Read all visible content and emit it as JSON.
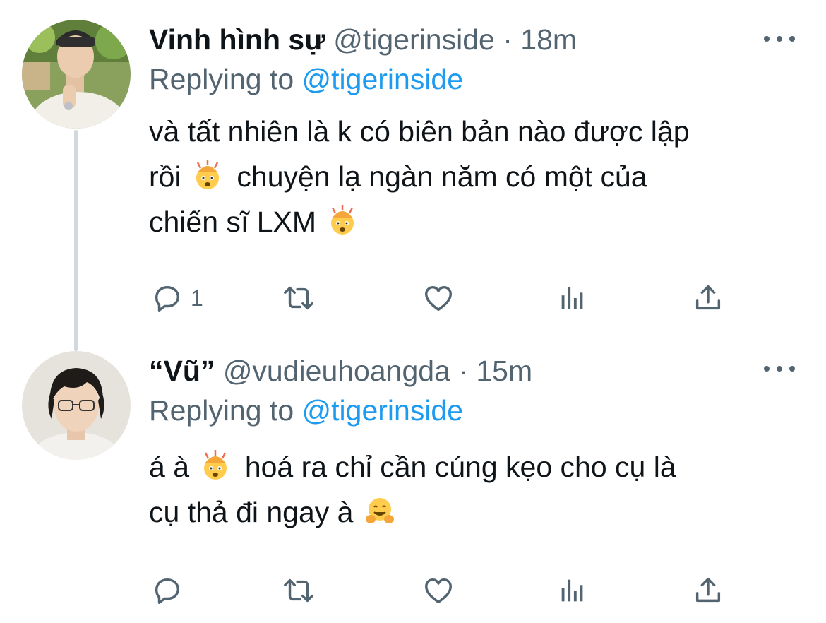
{
  "tweets": [
    {
      "author_name": "Vinh hình sự",
      "handle": "@tigerinside",
      "time": "18m",
      "replying_label": "Replying to",
      "replying_to": "@tigerinside",
      "lines": [
        {
          "text": "và tất nhiên là k có biên bản nào được lập",
          "emoji": ""
        },
        {
          "text_before": "rồi",
          "emoji": "exploding-head",
          "text_after": "chuyện lạ ngàn năm có một của"
        },
        {
          "text": "chiến sĩ LXM",
          "emoji": "exploding-head"
        }
      ],
      "reply_count": "1",
      "retweet_count": "",
      "like_count": ""
    },
    {
      "author_name": "“Vũ”",
      "handle": "@vudieuhoangda",
      "time": "15m",
      "replying_label": "Replying to",
      "replying_to": "@tigerinside",
      "lines": [
        {
          "text_before": "á à",
          "emoji": "exploding-head",
          "text_after": "hoá ra chỉ cần cúng kẹo cho cụ là"
        },
        {
          "text": "cụ thả đi ngay à",
          "emoji": "hugging-face"
        }
      ],
      "reply_count": "",
      "retweet_count": "",
      "like_count": ""
    }
  ],
  "icons": {
    "reply": "reply-icon",
    "retweet": "retweet-icon",
    "like": "heart-icon",
    "views": "analytics-icon",
    "share": "share-icon",
    "more": "more-icon"
  },
  "colors": {
    "text": "#0f1419",
    "secondary": "#536471",
    "link": "#1d9bf0",
    "thread_line": "#cfd9de"
  }
}
